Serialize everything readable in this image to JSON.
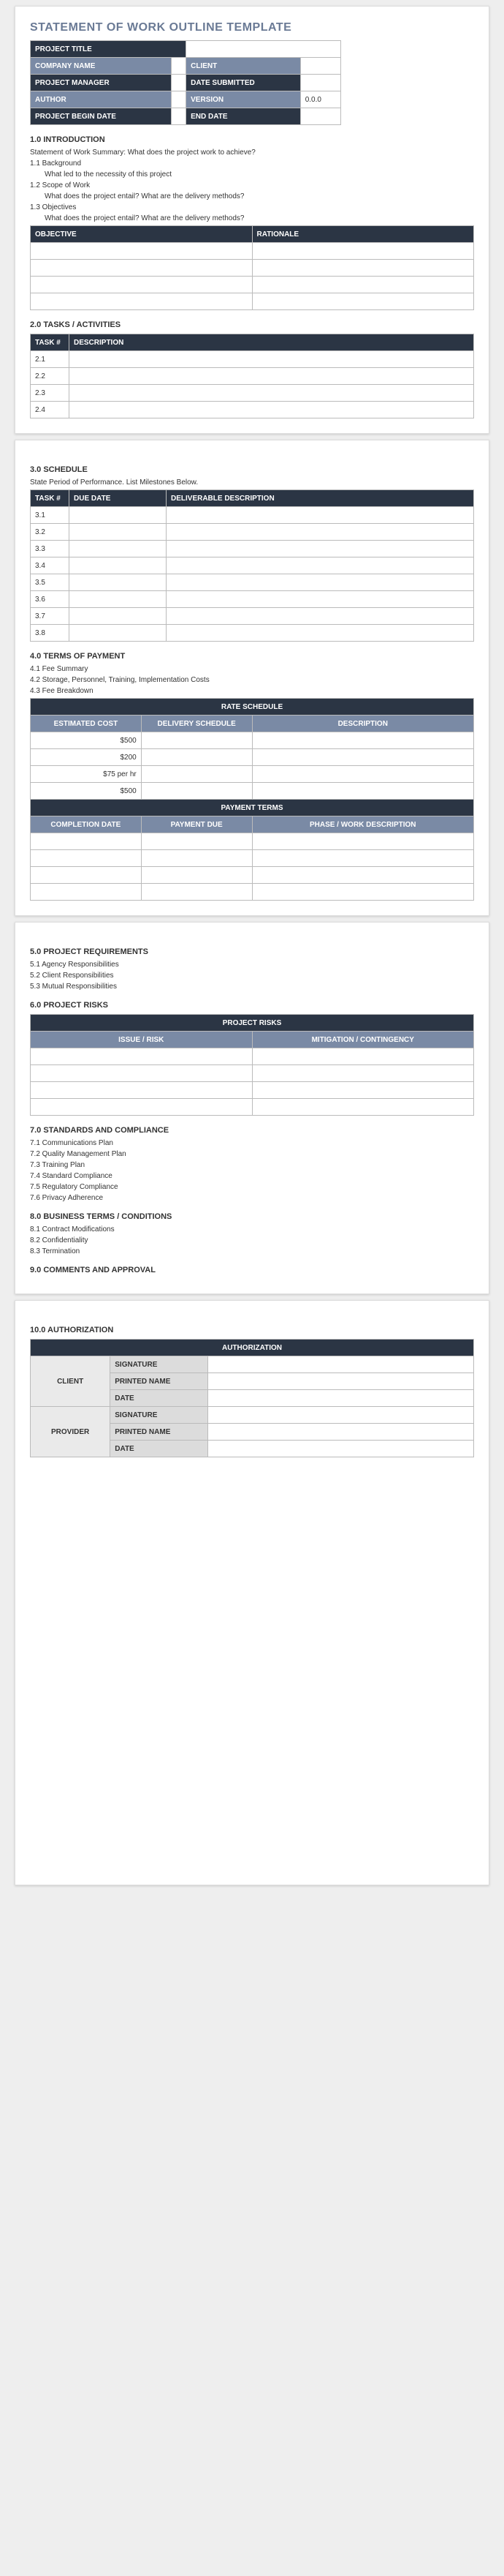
{
  "title": "STATEMENT OF WORK OUTLINE TEMPLATE",
  "hdr": {
    "projectTitle": "PROJECT TITLE",
    "companyName": "COMPANY NAME",
    "client": "CLIENT",
    "projectManager": "PROJECT MANAGER",
    "dateSubmitted": "DATE SUBMITTED",
    "author": "AUTHOR",
    "version": "VERSION",
    "versionVal": "0.0.0",
    "beginDate": "PROJECT BEGIN DATE",
    "endDate": "END DATE"
  },
  "s1": {
    "h": "1.0 INTRODUCTION",
    "summary": "Statement of Work Summary: What does the project work to achieve?",
    "b1": "1.1 Background",
    "b1t": "What led to the necessity of this project",
    "b2": "1.2 Scope of Work",
    "b2t": "What does the project entail? What are the delivery methods?",
    "b3": "1.3 Objectives",
    "b3t": "What does the project entail? What are the delivery methods?",
    "objH": "OBJECTIVE",
    "ratH": "RATIONALE"
  },
  "s2": {
    "h": "2.0 TASKS / ACTIVITIES",
    "th1": "TASK #",
    "th2": "DESCRIPTION",
    "rows": [
      "2.1",
      "2.2",
      "2.3",
      "2.4"
    ]
  },
  "s3": {
    "h": "3.0 SCHEDULE",
    "sub": "State Period of Performance. List Milestones Below.",
    "th1": "TASK #",
    "th2": "DUE DATE",
    "th3": "DELIVERABLE DESCRIPTION",
    "rows": [
      "3.1",
      "3.2",
      "3.3",
      "3.4",
      "3.5",
      "3.6",
      "3.7",
      "3.8"
    ]
  },
  "s4": {
    "h": "4.0 TERMS OF PAYMENT",
    "i1": "4.1 Fee Summary",
    "i2": "4.2 Storage, Personnel, Training, Implementation Costs",
    "i3": "4.3 Fee Breakdown",
    "rateH": "RATE SCHEDULE",
    "rc1": "ESTIMATED COST",
    "rc2": "DELIVERY SCHEDULE",
    "rc3": "DESCRIPTION",
    "costs": [
      "$500",
      "$200",
      "$75 per hr",
      "$500"
    ],
    "payH": "PAYMENT TERMS",
    "pc1": "COMPLETION DATE",
    "pc2": "PAYMENT DUE",
    "pc3": "PHASE / WORK DESCRIPTION"
  },
  "s5": {
    "h": "5.0 PROJECT REQUIREMENTS",
    "i1": "5.1 Agency Responsibilities",
    "i2": "5.2 Client Responsibilities",
    "i3": "5.3 Mutual Responsibilities"
  },
  "s6": {
    "h": "6.0 PROJECT RISKS",
    "band": "PROJECT RISKS",
    "c1": "ISSUE / RISK",
    "c2": "MITIGATION / CONTINGENCY"
  },
  "s7": {
    "h": "7.0 STANDARDS AND COMPLIANCE",
    "i1": "7.1 Communications Plan",
    "i2": "7.2 Quality Management Plan",
    "i3": "7.3 Training Plan",
    "i4": "7.4 Standard Compliance",
    "i5": "7.5 Regulatory Compliance",
    "i6": "7.6 Privacy Adherence"
  },
  "s8": {
    "h": "8.0 BUSINESS TERMS / CONDITIONS",
    "i1": "8.1 Contract Modifications",
    "i2": "8.2 Confidentiality",
    "i3": "8.3 Termination"
  },
  "s9": {
    "h": "9.0 COMMENTS AND APPROVAL"
  },
  "s10": {
    "h": "10.0  AUTHORIZATION",
    "band": "AUTHORIZATION",
    "client": "CLIENT",
    "provider": "PROVIDER",
    "sig": "SIGNATURE",
    "pn": "PRINTED NAME",
    "date": "DATE"
  }
}
